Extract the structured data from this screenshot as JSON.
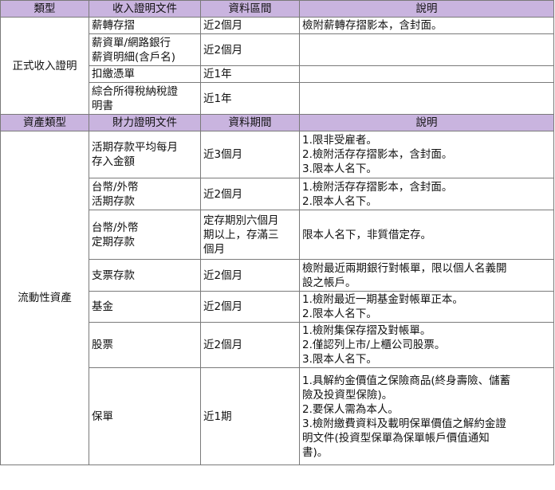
{
  "headers1": [
    "類型",
    "收入證明文件",
    "資料區間",
    "說明"
  ],
  "income": {
    "category": "正式收入證明",
    "rows": [
      {
        "doc": [
          "薪轉存摺"
        ],
        "period": "近2個月",
        "note": [
          "檢附薪轉存摺影本，含封面。"
        ]
      },
      {
        "doc": [
          "薪資單/網路銀行",
          "薪資明細(含戶名)"
        ],
        "period": "近2個月",
        "note": []
      },
      {
        "doc": [
          "扣繳憑單"
        ],
        "period": "近1年",
        "note": []
      },
      {
        "doc": [
          "綜合所得稅納稅證",
          "明書"
        ],
        "period": "近1年",
        "note": []
      }
    ]
  },
  "headers2": [
    "資產類型",
    "財力證明文件",
    "資料期間",
    "說明"
  ],
  "assets": {
    "category": "流動性資產",
    "rows": [
      {
        "doc": [
          "活期存款平均每月",
          "存入金額"
        ],
        "period": [
          "近3個月"
        ],
        "note": [
          " 1.限非受雇者。",
          " 2.檢附活存存摺影本，含封面。",
          " 3.限本人名下。"
        ]
      },
      {
        "doc": [
          "台幣/外幣",
          "活期存款"
        ],
        "period": [
          "近2個月"
        ],
        "note": [
          "1.檢附活存存摺影本，含封面。",
          "2.限本人名下。"
        ]
      },
      {
        "doc": [
          "台幣/外幣",
          "定期存款"
        ],
        "period": [
          "定存期別六個月",
          "期以上，存滿三",
          "個月"
        ],
        "note": [
          "限本人名下，非質借定存。"
        ]
      },
      {
        "doc": [
          "支票存款"
        ],
        "period": [
          "近2個月"
        ],
        "note": [
          "檢附最近兩期銀行對帳單，限以個人名義開",
          "設之帳戶。"
        ]
      },
      {
        "doc": [
          "基金"
        ],
        "period": [
          "近2個月"
        ],
        "note": [
          "1.檢附最近一期基金對帳單正本。",
          "2.限本人名下。"
        ]
      },
      {
        "doc": [
          "股票"
        ],
        "period": [
          "近2個月"
        ],
        "note": [
          "1.檢附集保存摺及對帳單。",
          "2.僅認列上市/上櫃公司股票。",
          "3.限本人名下。"
        ]
      },
      {
        "doc": [
          "保單"
        ],
        "period": [
          "近1期"
        ],
        "note": [
          "1.具解約金價值之保險商品(終身壽險、儲蓄",
          "險及投資型保險)。",
          "2.要保人需為本人。",
          "3.檢附繳費資料及載明保單價值之解約金證",
          "明文件(投資型保單為保單帳戶價值通知",
          "書)。"
        ]
      }
    ]
  }
}
